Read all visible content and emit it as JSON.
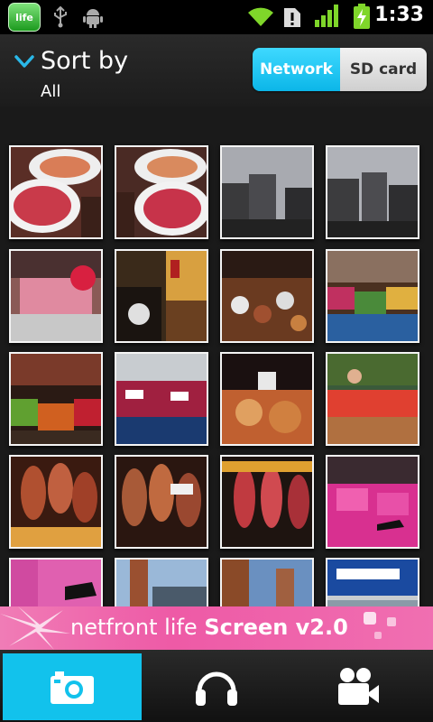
{
  "status_bar": {
    "app_icon_text": "life",
    "time": "1:33"
  },
  "header": {
    "sort_label": "Sort by",
    "sort_value": "All",
    "source_options": [
      "Network",
      "SD card"
    ],
    "selected_source": "Network"
  },
  "banner": {
    "brand": "netfront life",
    "product": "Screen v2.0"
  },
  "tabs": [
    {
      "name": "photos",
      "icon": "camera-icon",
      "selected": true
    },
    {
      "name": "music",
      "icon": "headphones-icon",
      "selected": false
    },
    {
      "name": "video",
      "icon": "video-camera-icon",
      "selected": false
    }
  ],
  "colors": {
    "accent": "#12c2ec",
    "banner": "#ee5aa6",
    "status_signal": "#7fd62a"
  },
  "thumbnails": [
    {
      "subject": "food-plates"
    },
    {
      "subject": "food-plates"
    },
    {
      "subject": "city-street"
    },
    {
      "subject": "city-street"
    },
    {
      "subject": "meat-counter"
    },
    {
      "subject": "market-stall"
    },
    {
      "subject": "produce-market"
    },
    {
      "subject": "produce-market"
    },
    {
      "subject": "fruit-stall"
    },
    {
      "subject": "seafood-counter"
    },
    {
      "subject": "market-food"
    },
    {
      "subject": "produce-stall"
    },
    {
      "subject": "ham-display"
    },
    {
      "subject": "ham-display"
    },
    {
      "subject": "ham-display"
    },
    {
      "subject": "shoe-shop"
    },
    {
      "subject": "shoe-shop"
    },
    {
      "subject": "street-building"
    },
    {
      "subject": "street-building"
    },
    {
      "subject": "store-sign"
    }
  ]
}
